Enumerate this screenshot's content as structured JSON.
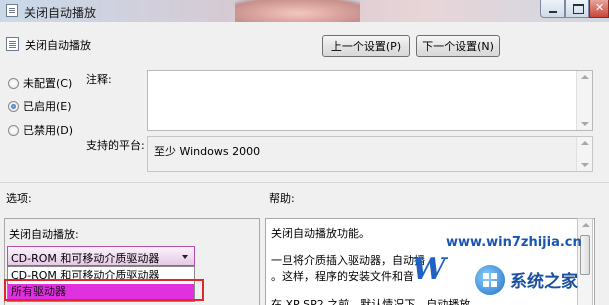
{
  "window": {
    "title": "关闭自动播放"
  },
  "header": {
    "title": "关闭自动播放",
    "prev_button": "上一个设置(P)",
    "next_button": "下一个设置(N)"
  },
  "state": {
    "options": [
      {
        "label": "未配置(C)",
        "selected": false
      },
      {
        "label": "已启用(E)",
        "selected": true
      },
      {
        "label": "已禁用(D)",
        "selected": false
      }
    ]
  },
  "comment": {
    "label": "注释:",
    "value": ""
  },
  "platform": {
    "label": "支持的平台:",
    "value": "至少 Windows 2000"
  },
  "options_section": {
    "label": "选项:",
    "field_label": "关闭自动播放:",
    "selected_value": "CD-ROM 和可移动介质驱动器",
    "dropdown_items": [
      "CD-ROM 和可移动介质驱动器",
      "所有驱动器"
    ],
    "highlighted_item": "所有驱动器"
  },
  "help_section": {
    "label": "帮助:",
    "lines": [
      "关闭自动播放功能。",
      "一旦将介质插入驱动器，自动播",
      "。这样，程序的安装文件和音",
      "在 XP SP2 之前，默认情况下，自动播放"
    ]
  },
  "watermark": {
    "url": "www.win7zhijia.cn",
    "letter": "W",
    "brand": "系统之家"
  },
  "colors": {
    "highlight": "#e030e0",
    "annotation_box": "#e0272b"
  }
}
